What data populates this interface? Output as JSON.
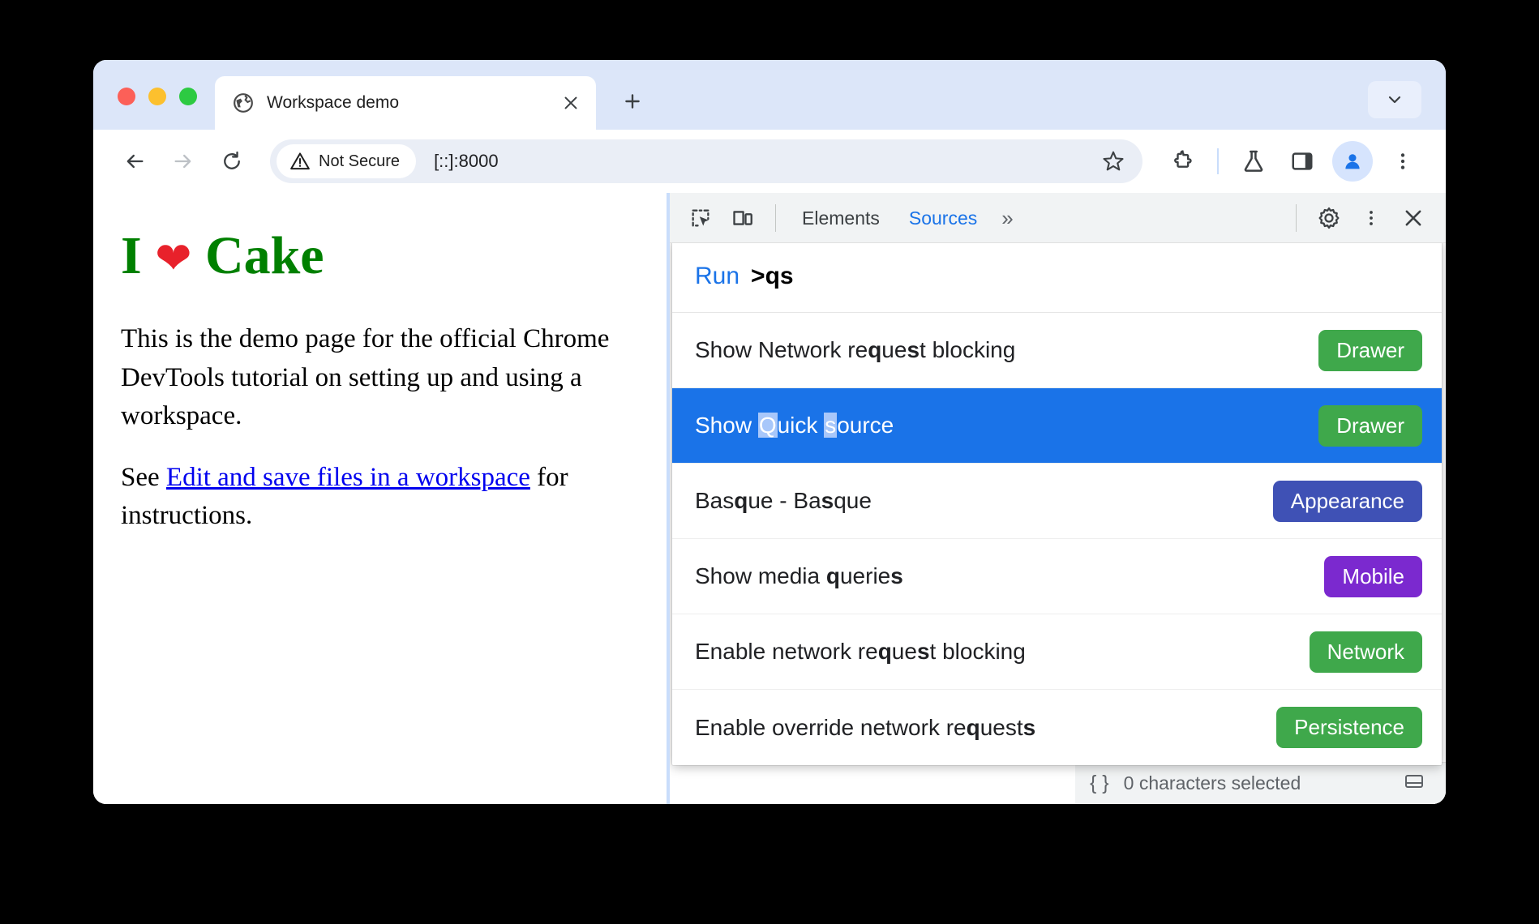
{
  "browser": {
    "tab": {
      "title": "Workspace demo",
      "favicon_icon": "globe-icon",
      "close_icon": "close-icon"
    },
    "new_tab_label": "+",
    "tab_list_icon": "chevron-down-icon",
    "toolbar": {
      "back_icon": "arrow-left-icon",
      "forward_icon": "arrow-right-icon",
      "reload_icon": "reload-icon",
      "security_label": "Not Secure",
      "security_icon": "warning-triangle-icon",
      "url": "[::]:8000",
      "bookmark_icon": "star-icon",
      "extensions_icon": "puzzle-piece-icon",
      "experiments_icon": "flask-icon",
      "side_panel_icon": "side-panel-icon",
      "profile_icon": "avatar-icon",
      "menu_icon": "three-dot-menu-icon"
    }
  },
  "page": {
    "heading_pre": "I ",
    "heading_heart": "❤",
    "heading_post": " Cake",
    "paragraph1": "This is the demo page for the official Chrome DevTools tutorial on setting up and using a workspace.",
    "paragraph2_pre": "See ",
    "link_text": "Edit and save files in a workspace",
    "paragraph2_post": " for instructions."
  },
  "devtools": {
    "inspect_icon": "inspect-element-icon",
    "device_icon": "device-toolbar-icon",
    "tabs": [
      {
        "label": "Elements",
        "active": false
      },
      {
        "label": "Sources",
        "active": true
      }
    ],
    "more_tabs_label": "»",
    "settings_icon": "gear-icon",
    "menu_icon": "three-dot-menu-icon",
    "close_icon": "close-icon",
    "status_bar": {
      "format_icon": "{ }",
      "selection_text": "0 characters selected",
      "layout_icon": "drawer-icon"
    },
    "command_palette": {
      "prefix": "Run",
      "query": ">qs",
      "rows": [
        {
          "parts": [
            {
              "t": "Show Network re",
              "b": false
            },
            {
              "t": "q",
              "b": true
            },
            {
              "t": "ue",
              "b": false
            },
            {
              "t": "s",
              "b": true
            },
            {
              "t": "t blocking",
              "b": false
            }
          ],
          "badge": "Drawer",
          "badge_color": "#3fa84b",
          "selected": false
        },
        {
          "parts": [
            {
              "t": "Show ",
              "b": false
            },
            {
              "t": "Q",
              "b": true
            },
            {
              "t": "uick ",
              "b": false
            },
            {
              "t": "s",
              "b": true
            },
            {
              "t": "ource",
              "b": false
            }
          ],
          "badge": "Drawer",
          "badge_color": "#3fa84b",
          "selected": true
        },
        {
          "parts": [
            {
              "t": "Bas",
              "b": false
            },
            {
              "t": "q",
              "b": true
            },
            {
              "t": "ue - Ba",
              "b": false
            },
            {
              "t": "s",
              "b": true
            },
            {
              "t": "que",
              "b": false
            }
          ],
          "badge": "Appearance",
          "badge_color": "#3f51b5",
          "selected": false
        },
        {
          "parts": [
            {
              "t": "Show media ",
              "b": false
            },
            {
              "t": "q",
              "b": true
            },
            {
              "t": "uerie",
              "b": false
            },
            {
              "t": "s",
              "b": true
            },
            {
              "t": "",
              "b": false
            }
          ],
          "badge": "Mobile",
          "badge_color": "#7b29cf",
          "selected": false
        },
        {
          "parts": [
            {
              "t": "Enable network re",
              "b": false
            },
            {
              "t": "q",
              "b": true
            },
            {
              "t": "ue",
              "b": false
            },
            {
              "t": "s",
              "b": true
            },
            {
              "t": "t blocking",
              "b": false
            }
          ],
          "badge": "Network",
          "badge_color": "#3fa84b",
          "selected": false
        },
        {
          "parts": [
            {
              "t": "Enable override network re",
              "b": false
            },
            {
              "t": "q",
              "b": true
            },
            {
              "t": "uest",
              "b": false
            },
            {
              "t": "s",
              "b": true
            },
            {
              "t": "",
              "b": false
            }
          ],
          "badge": "Persistence",
          "badge_color": "#3fa84b",
          "selected": false
        }
      ]
    }
  }
}
